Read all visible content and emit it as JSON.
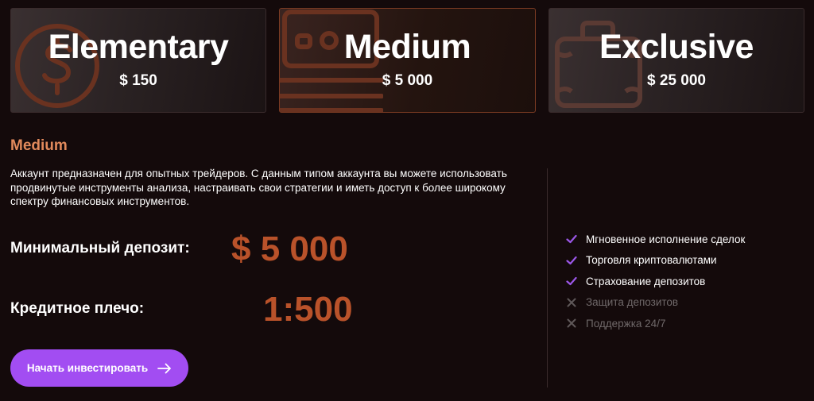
{
  "plans": [
    {
      "name": "Elementary",
      "price": "$ 150",
      "icon": "dollar-coin-icon",
      "selected": false
    },
    {
      "name": "Medium",
      "price": "$ 5 000",
      "icon": "banknote-icon",
      "selected": true
    },
    {
      "name": "Exclusive",
      "price": "$ 25 000",
      "icon": "briefcase-icon",
      "selected": false
    }
  ],
  "details": {
    "title": "Medium",
    "description": "Аккаунт предназначен для опытных трейдеров. С данным типом аккаунта вы можете использовать продвинутые инструменты анализа, настраивать свои стратегии и иметь доступ к более широкому спектру финансовых инструментов.",
    "min_deposit_label": "Минимальный депозит:",
    "min_deposit_value": "$ 5 000",
    "leverage_label": "Кредитное плечо:",
    "leverage_value": "1:500"
  },
  "features": [
    {
      "label": "Мгновенное исполнение сделок",
      "enabled": true
    },
    {
      "label": "Торговля криптовалютами",
      "enabled": true
    },
    {
      "label": "Страхование депозитов",
      "enabled": true
    },
    {
      "label": "Защита депозитов",
      "enabled": false
    },
    {
      "label": "Поддержка 24/7",
      "enabled": false
    }
  ],
  "cta": {
    "label": "Начать инвестировать",
    "icon": "arrow-right-icon"
  },
  "colors": {
    "accent_orange": "#e28a5c",
    "value_orange": "#b9522a",
    "purple": "#a24df2",
    "check_purple": "#9b57e8",
    "disabled_gray": "#6f6869",
    "background": "#140a0b"
  }
}
